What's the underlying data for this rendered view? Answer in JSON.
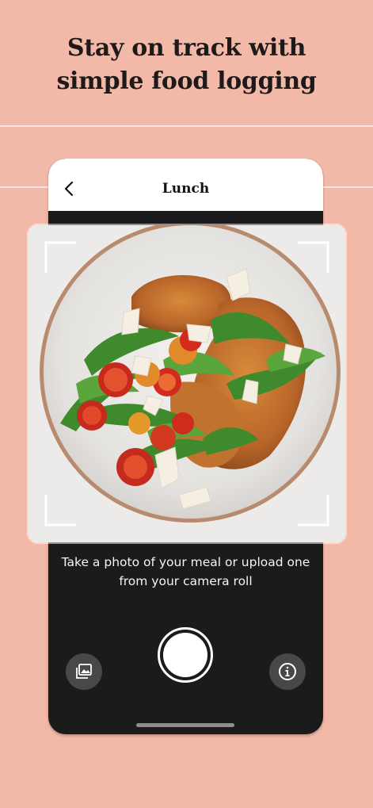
{
  "headline": {
    "line1": "Stay on track with",
    "line2": "simple food logging"
  },
  "screen": {
    "title": "Lunch",
    "back_icon": "chevron-left-icon"
  },
  "photo": {
    "subject": "food-photo",
    "frame_icon": "viewfinder-corners"
  },
  "camera": {
    "caption_line1": "Take a photo of your meal or upload one",
    "caption_line2": "from your camera roll",
    "gallery_icon": "photo-library-icon",
    "info_icon": "info-icon",
    "shutter_icon": "shutter-button"
  },
  "colors": {
    "background": "#f2b9a8",
    "phone_dark": "#1c1b1c",
    "header_white": "#ffffff",
    "round_button": "#4a4748"
  }
}
